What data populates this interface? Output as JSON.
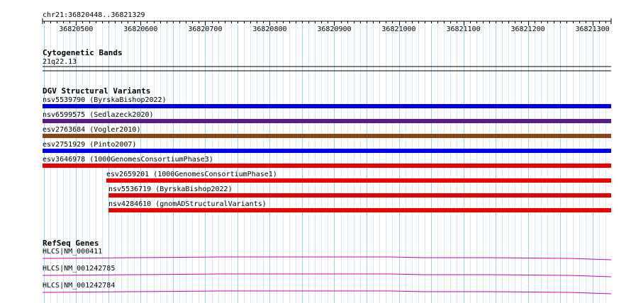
{
  "browser": {
    "location": "chr21:36820448..36821329",
    "ruler": {
      "start": 36820448,
      "end": 36821329,
      "tick_labels": [
        "36820500",
        "36820600",
        "36820700",
        "36820800",
        "36820900",
        "36821000",
        "36821100",
        "36821200",
        "36821300"
      ]
    }
  },
  "tracks": {
    "cytoband": {
      "title": "Cytogenetic Bands",
      "band_label": "21q22.13"
    },
    "dgv": {
      "title": "DGV Structural Variants",
      "features": [
        {
          "label": "nsv5539790 (ByrskaBishop2022)",
          "start": 36820448,
          "end": 36821329,
          "color": "#0000ee"
        },
        {
          "label": "nsv6599575 (Sedlazeck2020)",
          "start": 36820448,
          "end": 36821329,
          "color": "#5a1a8c"
        },
        {
          "label": "esv2763684 (Vogler2010)",
          "start": 36820448,
          "end": 36821329,
          "color": "#8b4513"
        },
        {
          "label": "esv2751929 (Pinto2007)",
          "start": 36820448,
          "end": 36821329,
          "color": "#0000ee"
        },
        {
          "label": "esv3646978 (1000GenomesConsortiumPhase3)",
          "start": 36820448,
          "end": 36821329,
          "color": "#ee0000"
        },
        {
          "label": "esv2659201 (1000GenomesConsortiumPhase1)",
          "start": 36820547,
          "end": 36821329,
          "color": "#ee0000"
        },
        {
          "label": "nsv5536719 (ByrskaBishop2022)",
          "start": 36820550,
          "end": 36821329,
          "color": "#ee0000"
        },
        {
          "label": "nsv4284610 (gnomADStructuralVariants)",
          "start": 36820550,
          "end": 36821329,
          "color": "#ee0000"
        }
      ]
    },
    "refseq": {
      "title": "RefSeq Genes",
      "color": "#cc00cc",
      "genes": [
        {
          "label": "HLCS|NM_000411"
        },
        {
          "label": "HLCS|NM_001242785"
        },
        {
          "label": "HLCS|NM_001242784"
        }
      ]
    }
  }
}
